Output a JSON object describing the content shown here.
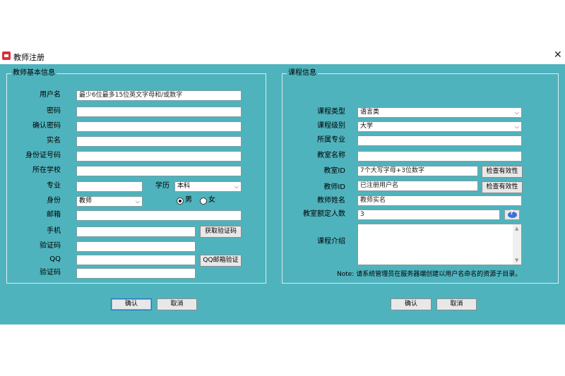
{
  "window": {
    "title": "教师注册",
    "close_glyph": "✕"
  },
  "left_group": {
    "title": "教师基本信息",
    "fields": {
      "username": {
        "label": "用户名",
        "placeholder": "最少6位最多15位英文字母和/或数字"
      },
      "password": {
        "label": "密码",
        "value": ""
      },
      "confirm_password": {
        "label": "确认密码",
        "value": ""
      },
      "real_name": {
        "label": "实名",
        "value": ""
      },
      "id_number": {
        "label": "身份证号码",
        "value": ""
      },
      "school": {
        "label": "所在学校",
        "value": ""
      },
      "major": {
        "label": "专业",
        "value": ""
      },
      "education": {
        "label": "学历",
        "selected": "本科"
      },
      "identity": {
        "label": "身份",
        "selected": "教师"
      },
      "gender": {
        "male": "男",
        "female": "女",
        "selected": "male"
      },
      "email": {
        "label": "邮箱",
        "value": ""
      },
      "phone": {
        "label": "手机",
        "value": ""
      },
      "get_code_button": "获取验证码",
      "phone_code": {
        "label": "验证码",
        "value": ""
      },
      "qq": {
        "label": "QQ",
        "value": ""
      },
      "qq_verify_button": "QQ邮箱验证",
      "qq_code": {
        "label": "验证码",
        "value": ""
      }
    },
    "confirm_button": "确认",
    "cancel_button": "取消"
  },
  "right_group": {
    "title": "课程信息",
    "fields": {
      "course_type": {
        "label": "课程类型",
        "selected": "语言类"
      },
      "course_level": {
        "label": "课程级别",
        "selected": "大学"
      },
      "major": {
        "label": "所属专业",
        "value": ""
      },
      "classroom_name": {
        "label": "教室名称",
        "value": ""
      },
      "classroom_id": {
        "label": "教室ID",
        "placeholder": "7个大写字母+3位数字"
      },
      "check_button_1": "检查有效性",
      "teacher_id": {
        "label": "教师ID",
        "placeholder": "已注册用户名"
      },
      "check_button_2": "检查有效性",
      "teacher_name": {
        "label": "教师姓名",
        "placeholder": "教师实名"
      },
      "capacity": {
        "label": "教室额定人数",
        "value": "3"
      },
      "intro": {
        "label": "课程介绍",
        "value": ""
      }
    },
    "note": "Note: 请系统管理员在服务器端创建以用户名命名的资源子目录。",
    "confirm_button": "确认",
    "cancel_button": "取消"
  },
  "icons": {
    "app": "app-icon",
    "close": "close-icon",
    "dropdown": "chevron-down-icon",
    "help": "help-icon"
  },
  "colors": {
    "client_bg": "#4fb3bd",
    "group_border": "#d8eef0",
    "button_bg": "#e8e8e8",
    "primary_border": "#2a6fc9"
  }
}
